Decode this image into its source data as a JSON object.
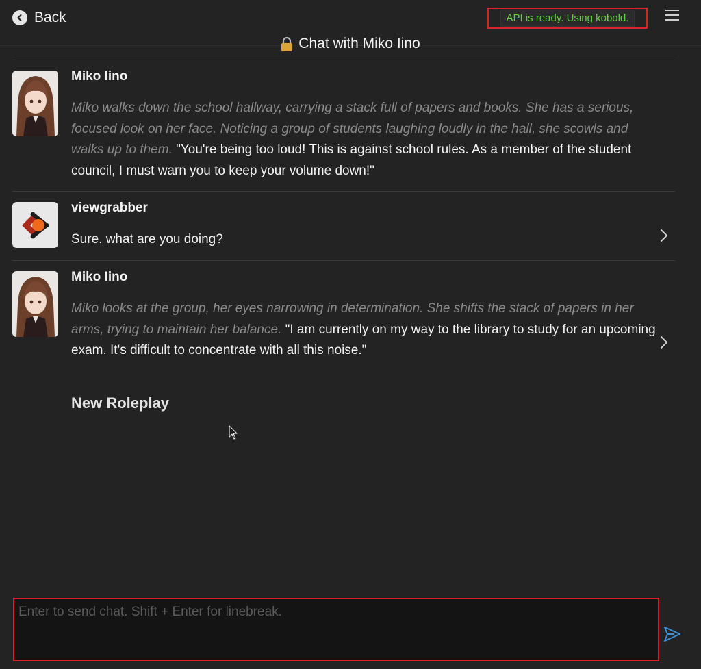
{
  "header": {
    "back_label": "Back",
    "api_status": "API is ready. Using kobold.",
    "title": "Chat with Miko Iino"
  },
  "messages": [
    {
      "name": "Miko Iino",
      "action": "Miko walks down the school hallway, carrying a stack full of papers and books. She has a serious, focused look on her face. Noticing a group of students laughing loudly in the hall, she scowls and walks up to them.",
      "speech": "\"You're being too loud! This is against school rules. As a member of the student council, I must warn you to keep your volume down!\""
    },
    {
      "name": "viewgrabber",
      "text": "Sure. what are you doing?"
    },
    {
      "name": "Miko Iino",
      "action": "Miko looks at the group, her eyes narrowing in determination. She shifts the stack of papers in her arms, trying to maintain her balance.",
      "speech": "\"I am currently on my way to the library to study for an upcoming exam. It's difficult to concentrate with all this noise.\""
    }
  ],
  "new_roleplay_label": "New Roleplay",
  "composer": {
    "placeholder": "Enter to send chat. Shift + Enter for linebreak."
  },
  "colors": {
    "background": "#232323",
    "status_text": "#5fd23c",
    "highlight_border": "#d8232a",
    "send_icon": "#3d8fd6"
  }
}
